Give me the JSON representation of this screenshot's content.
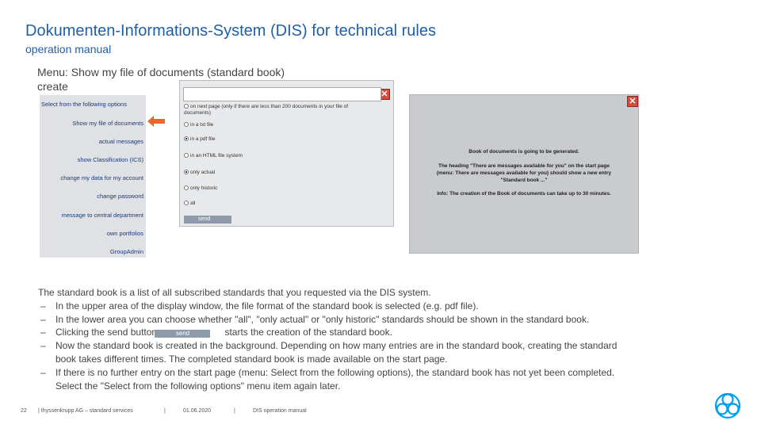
{
  "header": {
    "title": "Dokumenten-Informations-System (DIS) for technical rules",
    "subtitle": "operation manual"
  },
  "menu_caption": {
    "line1": "Menu: Show my file of documents (standard book)",
    "line2": "create"
  },
  "menu": {
    "items": [
      {
        "label": "Select from the following options"
      },
      {
        "label": "Show my file of documents"
      },
      {
        "label": "actual messages"
      },
      {
        "label": "show Classification (ICS)"
      },
      {
        "label": "change my data for my account"
      },
      {
        "label": "change password"
      },
      {
        "label": "message to central department"
      },
      {
        "label": "own portfolios"
      },
      {
        "label": "GroupAdmin"
      }
    ]
  },
  "options_dialog": {
    "close_icon": "close-icon",
    "options": [
      {
        "label_line1": "on next page (only if there are less than 200 documents in your file of",
        "label_line2": "documents)",
        "selected": false
      },
      {
        "label_line1": "in a txt file",
        "label_line2": "",
        "selected": false
      },
      {
        "label_line1": "in a pdf file",
        "label_line2": "",
        "selected": true
      },
      {
        "label_line1": "in an HTML file system",
        "label_line2": "",
        "selected": false
      },
      {
        "label_line1": "only actual",
        "label_line2": "",
        "selected": true
      },
      {
        "label_line1": "only historic",
        "label_line2": "",
        "selected": false
      },
      {
        "label_line1": "all",
        "label_line2": "",
        "selected": false
      }
    ],
    "send_label": "send"
  },
  "notice_dialog": {
    "line1": "Book of documents is going to be generated.",
    "line2": "The heading \"There are messages available for you\" on the start page",
    "line3": "(menu: There are messages available for you) should show a new entry",
    "line4": "\"Standard book ...\"",
    "line5": "Info: The creation of the Book of documents can take up to 30 minutes."
  },
  "description": {
    "intro": "The standard book is a list of all subscribed standards that you requested via the DIS system.",
    "dash": "–",
    "bullet1": "In the upper area of the display window, the file format of the standard book is selected (e.g. pdf file).",
    "bullet2": "In the lower area you can choose whether \"all\", \"only actual\" or \"only historic\" standards should be shown in the standard book.",
    "bullet3_pre": "Clicking the send button",
    "bullet3_button": "send",
    "bullet3_post": "starts the creation of the standard book.",
    "bullet4_line1": "Now the standard book is created in the background. Depending on how many entries are in the standard book, creating the standard",
    "bullet4_line2": "book takes different times. The completed standard book is made available on the start page.",
    "bullet5_line1": "If there is no further entry on the start page (menu: Select from the following options), the standard book has not yet been completed.",
    "bullet5_line2": "Select the \"Select from the following options\" menu item again later."
  },
  "footer": {
    "page_number": "22",
    "company": "| thyssenkrupp AG – standard services",
    "sep1": "|",
    "date": "01.06.2020",
    "sep2": "|",
    "doc": "DIS operation manual"
  },
  "colors": {
    "accent": "#1f5fa8",
    "arrow": "#e8692a",
    "close": "#d84a3a",
    "button": "#8d9aaa"
  }
}
